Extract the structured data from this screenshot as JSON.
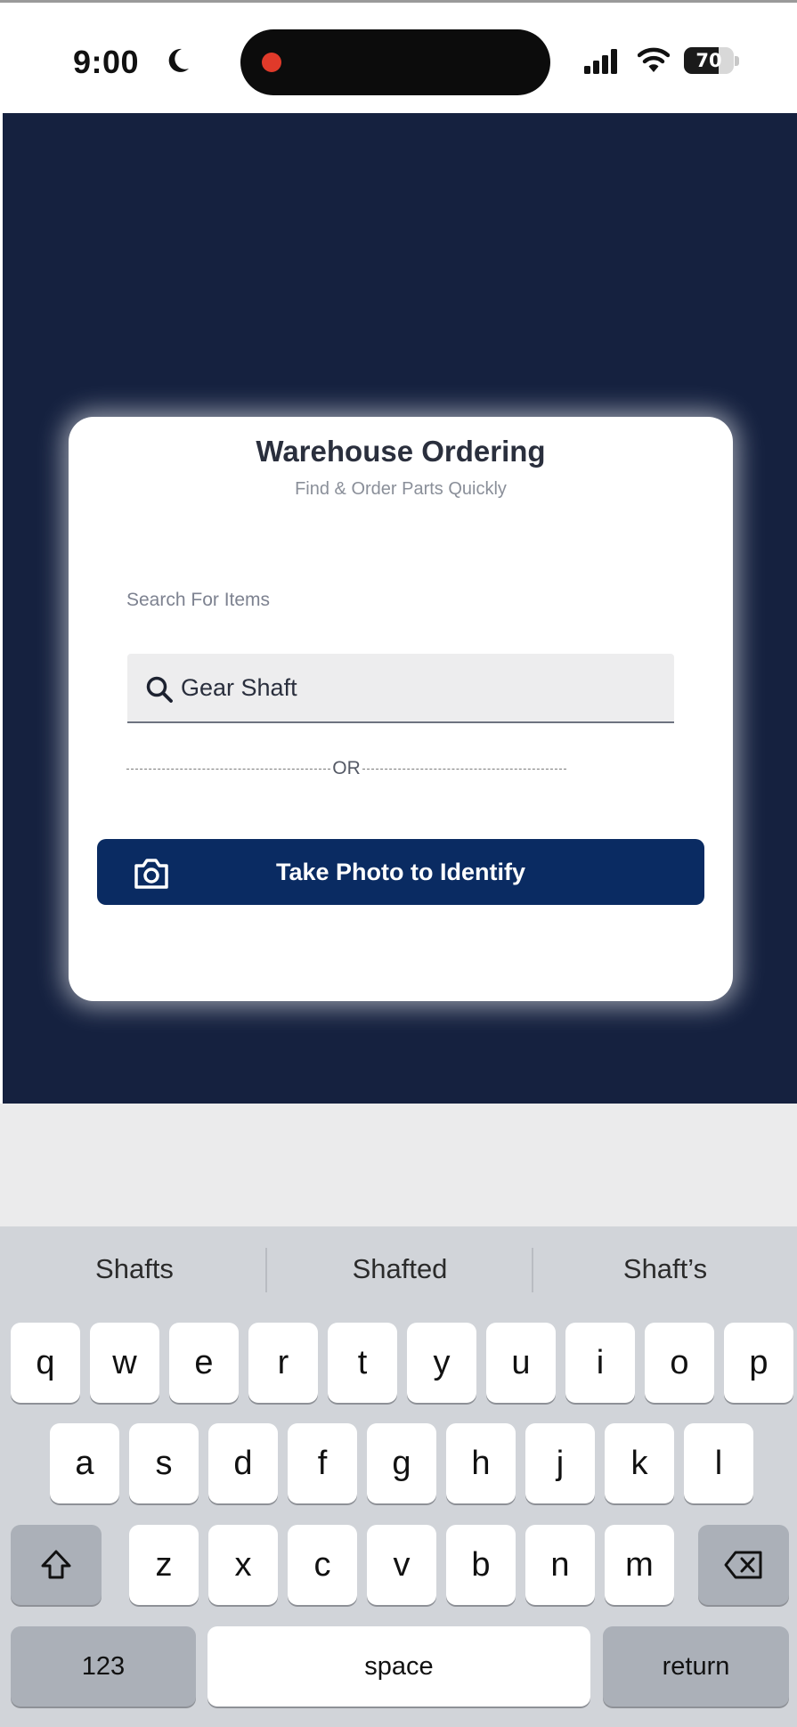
{
  "status_bar": {
    "time": "9:00",
    "battery": "70",
    "battery_level": 0.7
  },
  "card": {
    "title": "Warehouse Ordering",
    "subtitle": "Find & Order Parts Quickly",
    "search_label": "Search For Items",
    "search_value": "Gear Shaft",
    "or_text": "OR",
    "photo_button_label": "Take Photo to Identify"
  },
  "keyboard": {
    "suggestions": [
      "Shafts",
      "Shafted",
      "Shaft’s"
    ],
    "row1": [
      "q",
      "w",
      "e",
      "r",
      "t",
      "y",
      "u",
      "i",
      "o",
      "p"
    ],
    "row2": [
      "a",
      "s",
      "d",
      "f",
      "g",
      "h",
      "j",
      "k",
      "l"
    ],
    "row3": [
      "z",
      "x",
      "c",
      "v",
      "b",
      "n",
      "m"
    ],
    "numbers_label": "123",
    "space_label": "space",
    "return_label": "return"
  },
  "icons": {
    "shift": "shift-icon",
    "delete": "delete-icon",
    "camera": "camera-icon",
    "search": "search-icon"
  },
  "colors": {
    "app_background": "#15213f",
    "primary_button": "#0a2b62"
  }
}
